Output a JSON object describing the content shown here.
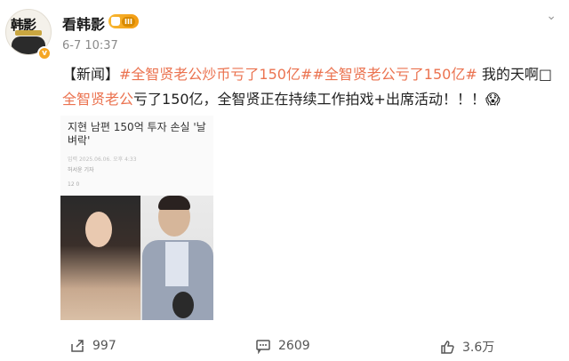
{
  "post": {
    "username": "看韩影",
    "level": "III",
    "time": "6-7 10:37",
    "content": {
      "prefix": "【新闻】",
      "tag1": "#全智贤老公炒币亏了150亿#",
      "tag2": "#全智贤老公亏了150亿#",
      "text1": " 我的天啊",
      "tag3": "全智贤老公",
      "text2": "亏了150亿，全智贤正在持续工作拍戏+出席活动！！！"
    }
  },
  "photo": {
    "headline": "지현 남편 150억 투자 손실 '날벼락'",
    "meta": "입력 2025.06.06. 오후 4:33",
    "author": "허서윤 기자",
    "stats": "12   0"
  },
  "actions": {
    "share_count": "997",
    "comment_count": "2609",
    "like_count": "3.6万"
  },
  "colors": {
    "accent": "#eb7350",
    "badge": "#f39c12"
  }
}
